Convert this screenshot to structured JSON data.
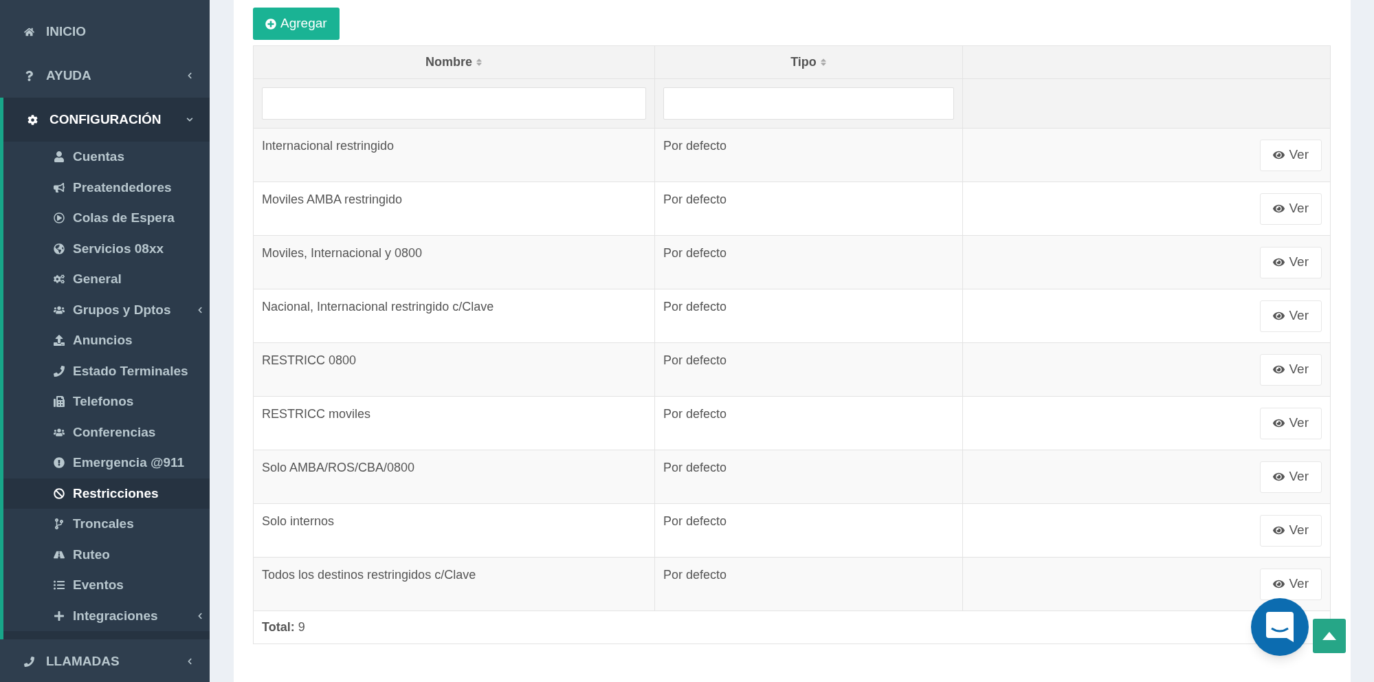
{
  "sidebar": {
    "items": [
      {
        "label": "INICIO",
        "selected": false
      },
      {
        "label": "AYUDA",
        "selected": false,
        "expanded": false
      },
      {
        "label": "CONFIGURACIÓN",
        "selected": true,
        "expanded": true,
        "children": [
          {
            "label": "Cuentas",
            "selected": false
          },
          {
            "label": "Preatendedores",
            "selected": false
          },
          {
            "label": "Colas de Espera",
            "selected": false
          },
          {
            "label": "Servicios 08xx",
            "selected": false
          },
          {
            "label": "General",
            "selected": false
          },
          {
            "label": "Grupos y Dptos",
            "selected": false,
            "expanded": false
          },
          {
            "label": "Anuncios",
            "selected": false
          },
          {
            "label": "Estado Terminales",
            "selected": false
          },
          {
            "label": "Telefonos",
            "selected": false
          },
          {
            "label": "Conferencias",
            "selected": false
          },
          {
            "label": "Emergencia @911",
            "selected": false
          },
          {
            "label": "Restricciones",
            "selected": true
          },
          {
            "label": "Troncales",
            "selected": false
          },
          {
            "label": "Ruteo",
            "selected": false
          },
          {
            "label": "Eventos",
            "selected": false
          },
          {
            "label": "Integraciones",
            "selected": false,
            "expanded": false
          }
        ]
      },
      {
        "label": "LLAMADAS",
        "selected": false,
        "expanded": false
      }
    ]
  },
  "add_button": "Agregar",
  "table": {
    "columns": [
      "Nombre",
      "Tipo"
    ],
    "rows": [
      {
        "nombre": "Internacional restringido",
        "tipo": "Por defecto",
        "action": "Ver"
      },
      {
        "nombre": "Moviles AMBA restringido",
        "tipo": "Por defecto",
        "action": "Ver"
      },
      {
        "nombre": "Moviles, Internacional y 0800",
        "tipo": "Por defecto",
        "action": "Ver"
      },
      {
        "nombre": "Nacional, Internacional restringido c/Clave",
        "tipo": "Por defecto",
        "action": "Ver"
      },
      {
        "nombre": "RESTRICC 0800",
        "tipo": "Por defecto",
        "action": "Ver"
      },
      {
        "nombre": "RESTRICC moviles",
        "tipo": "Por defecto",
        "action": "Ver"
      },
      {
        "nombre": "Solo AMBA/ROS/CBA/0800",
        "tipo": "Por defecto",
        "action": "Ver"
      },
      {
        "nombre": "Solo internos",
        "tipo": "Por defecto",
        "action": "Ver"
      },
      {
        "nombre": "Todos los destinos restringidos c/Clave",
        "tipo": "Por defecto",
        "action": "Ver"
      }
    ],
    "footer": "**Total:** 9"
  }
}
